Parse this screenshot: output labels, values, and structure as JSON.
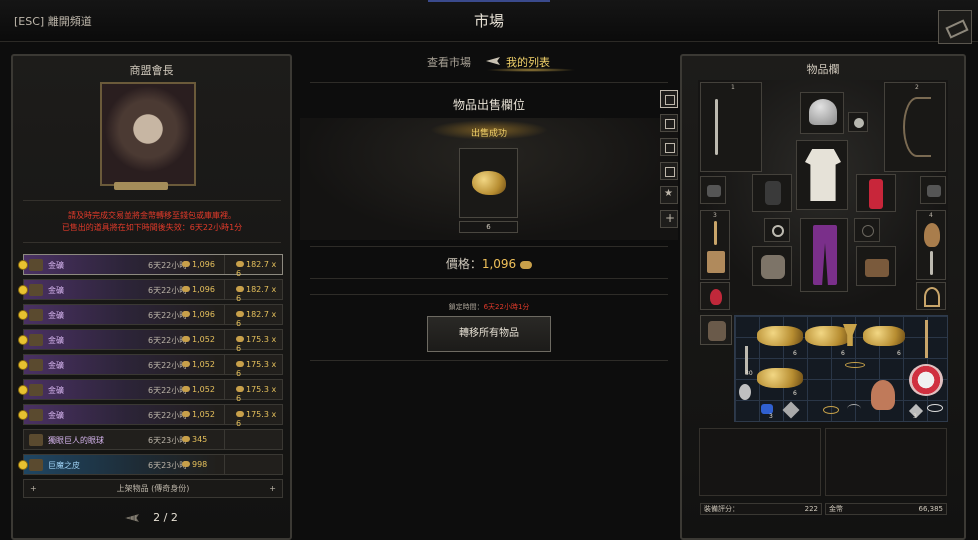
{
  "topbar": {
    "esc": "[ESC] 離開頻道",
    "title": "市場"
  },
  "left": {
    "title": "商盟會長",
    "notice_line1": "請及時完成交易並將金幣轉移至錢包或庫庫裡。",
    "notice_line2": "已售出的道具將在如下時間後失效：6天22小時1分",
    "rows": [
      {
        "name": "金礦",
        "time": "6天22小時",
        "price": "1,096",
        "unit": "182.7 x 6",
        "style": "purple",
        "selected": true
      },
      {
        "name": "金礦",
        "time": "6天22小時",
        "price": "1,096",
        "unit": "182.7 x 6",
        "style": "purple",
        "selected": false
      },
      {
        "name": "金礦",
        "time": "6天22小時",
        "price": "1,096",
        "unit": "182.7 x 6",
        "style": "purple",
        "selected": false
      },
      {
        "name": "金礦",
        "time": "6天22小時",
        "price": "1,052",
        "unit": "175.3 x 6",
        "style": "purple",
        "selected": false
      },
      {
        "name": "金礦",
        "time": "6天22小時",
        "price": "1,052",
        "unit": "175.3 x 6",
        "style": "purple",
        "selected": false
      },
      {
        "name": "金礦",
        "time": "6天22小時",
        "price": "1,052",
        "unit": "175.3 x 6",
        "style": "purple",
        "selected": false
      },
      {
        "name": "金礦",
        "time": "6天22小時",
        "price": "1,052",
        "unit": "175.3 x 6",
        "style": "purple",
        "selected": false
      },
      {
        "name": "獨眼巨人的眼球",
        "time": "6天23小時",
        "price": "345",
        "unit": "",
        "style": "plain",
        "selected": false
      },
      {
        "name": "巨魔之皮",
        "time": "6天23小時",
        "price": "998",
        "unit": "",
        "style": "blue",
        "selected": false
      }
    ],
    "add_listing": "上架物品 (傳奇身份)",
    "page": "2 / 2"
  },
  "middle": {
    "tab_view": "查看市場",
    "tab_mine": "我的列表",
    "heading": "物品出售欄位",
    "sold_label": "出售成功",
    "quantity": "6",
    "price_label": "價格：",
    "price_value": "1,096",
    "lock_label": "鎖定時間：",
    "lock_time": "6天22小時1分",
    "transfer_button": "轉移所有物品"
  },
  "right": {
    "title": "物品欄",
    "slot_num_1": "1",
    "slot_num_2": "2",
    "slot_num_3": "3",
    "slot_num_4": "4",
    "bag_counts": [
      "6",
      "6",
      "6",
      "30",
      "6",
      "3",
      "3"
    ],
    "gear_score_label": "裝備評分：",
    "gear_score": "222",
    "gold_label": "金幣",
    "gold": "66,385"
  }
}
